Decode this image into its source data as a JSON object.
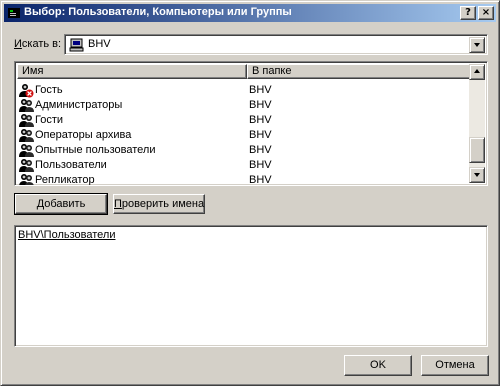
{
  "window": {
    "title": "Выбор: Пользователи, Компьютеры или Группы",
    "help_button": "?",
    "close_button": "×"
  },
  "lookin": {
    "label": "Искать в:",
    "label_hotkey": "И",
    "label_rest": "скать в:",
    "value": "BHV"
  },
  "list": {
    "columns": [
      "Имя",
      "В папке"
    ],
    "rows": [
      {
        "name": "Гость",
        "folder": "BHV",
        "icon": "disabled-user-icon"
      },
      {
        "name": "Администраторы",
        "folder": "BHV",
        "icon": "group-icon"
      },
      {
        "name": "Гости",
        "folder": "BHV",
        "icon": "group-icon"
      },
      {
        "name": "Операторы архива",
        "folder": "BHV",
        "icon": "group-icon"
      },
      {
        "name": "Опытные пользователи",
        "folder": "BHV",
        "icon": "group-icon"
      },
      {
        "name": "Пользователи",
        "folder": "BHV",
        "icon": "group-icon"
      },
      {
        "name": "Репликатор",
        "folder": "BHV",
        "icon": "group-icon"
      }
    ]
  },
  "buttons": {
    "add_hotkey": "Д",
    "add_pre": "",
    "add_rest": "обавить",
    "check_hotkey": "П",
    "check_rest": "роверить имена",
    "ok": "OK",
    "cancel": "Отмена"
  },
  "names_entry": {
    "value": "BHV\\Пользователи"
  }
}
